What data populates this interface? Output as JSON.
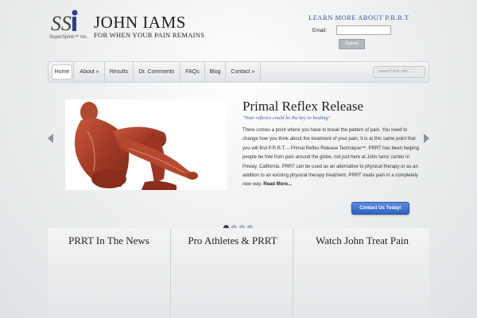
{
  "header": {
    "logo_tag": "SuperSpine™ Inc.",
    "site_title": "JOHN IAMS",
    "tagline": "FOR WHEN YOUR PAIN REMAINS",
    "learn_more": "LEARN MORE ABOUT P.R.R.T",
    "email_label": "Email:",
    "email_value": "",
    "submit_label": "Submit"
  },
  "nav": {
    "items": [
      {
        "label": "Home"
      },
      {
        "label": "About »"
      },
      {
        "label": "Results"
      },
      {
        "label": "Dr. Comments"
      },
      {
        "label": "FAQs"
      },
      {
        "label": "Blog"
      },
      {
        "label": "Contact »"
      }
    ],
    "search_placeholder": "search this site..."
  },
  "slide": {
    "title": "Primal Reflex Release",
    "quote": "\"Your reflexes could be the key to healing\"",
    "body": "There comes a point where you have to break the pattern of pain. You need to change how you think about the treatment of your pain. It is at this same point that you will find P.R.R.T. – Primal Reflex Release Technique™. PRRT has been helping people be free from pain around the globe, not just here at John Iams' center in Poway, California. PRRT can be used as an alternative to physical therapy or as an addition to an existing physical therapy treatment. PRRT treats pain in a completely new way.",
    "read_more": "Read More...",
    "cta_label": "Contact Us Today!",
    "dots_total": 4,
    "active_dot": 1
  },
  "bottom_boxes": [
    {
      "title": "PRRT In The News"
    },
    {
      "title": "Pro Athletes & PRRT"
    },
    {
      "title": "Watch John Treat Pain"
    }
  ],
  "colors": {
    "accent_blue": "#3a55a4",
    "cta_blue": "#3d6fd0"
  }
}
